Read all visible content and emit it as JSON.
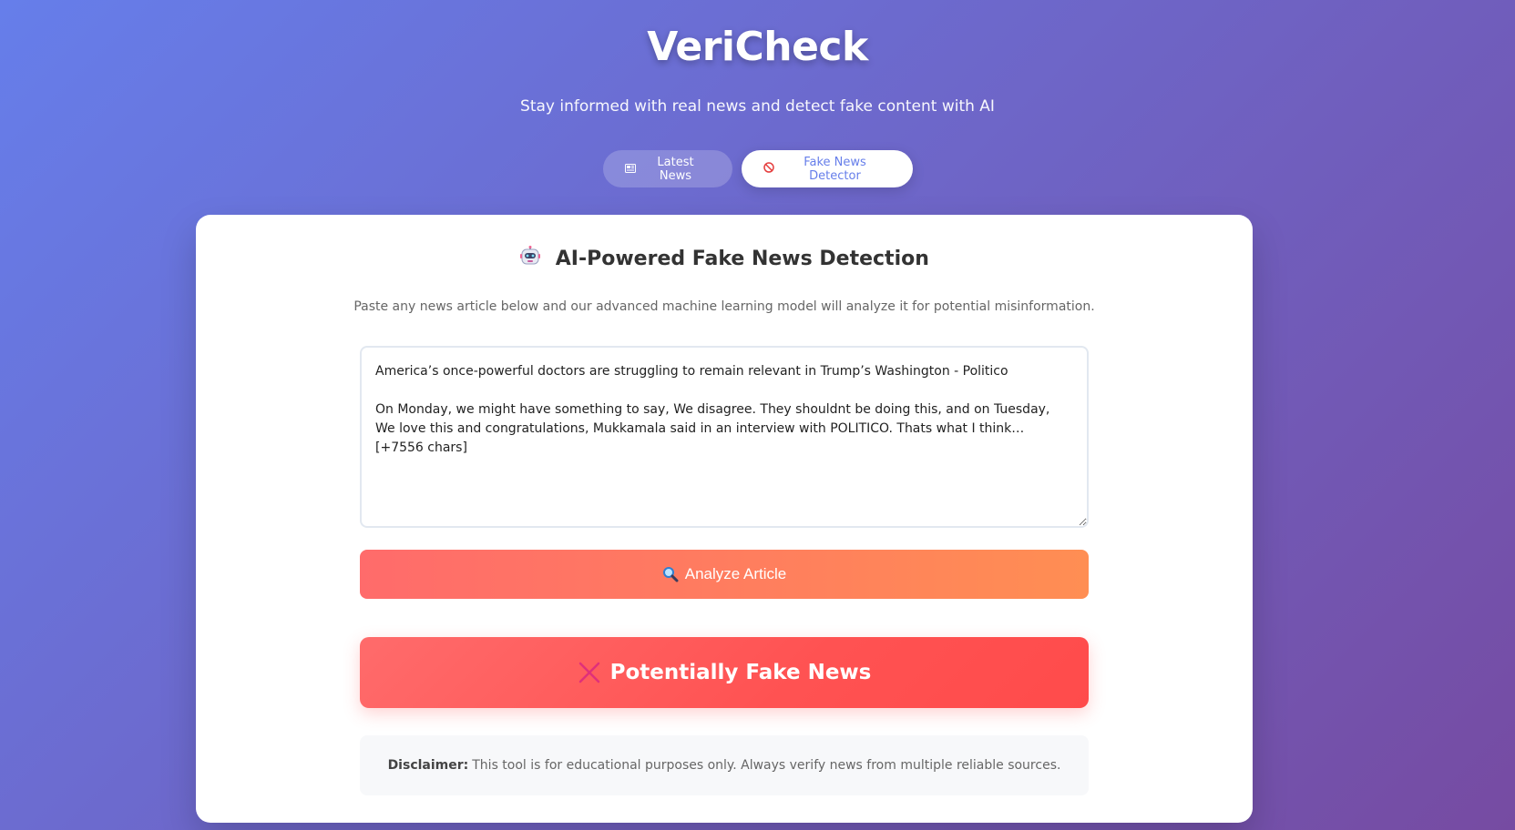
{
  "app": {
    "title": "VeriCheck",
    "subtitle": "Stay informed with real news and detect fake content with AI"
  },
  "tabs": [
    {
      "label": "Latest News",
      "icon": "newspaper-icon",
      "active": false
    },
    {
      "label": "Fake News Detector",
      "icon": "prohibited-icon",
      "active": true
    }
  ],
  "detector": {
    "heading": "AI-Powered Fake News Detection",
    "heading_icon": "robot-icon",
    "description": "Paste any news article below and our advanced machine learning model will analyze it for potential misinformation.",
    "article_text": "America’s once-powerful doctors are struggling to remain relevant in Trump’s Washington - Politico\n\nOn Monday, we might have something to say, We disagree. They shouldnt be doing this, and on Tuesday, We love this and congratulations, Mukkamala said in an interview with POLITICO. Thats what I think… [+7556 chars]",
    "analyze_label": "Analyze Article",
    "analyze_icon": "magnifying-glass-icon"
  },
  "result": {
    "label": "Potentially Fake News",
    "icon": "cross-icon",
    "color": "#ff5252"
  },
  "disclaimer": {
    "title": "Disclaimer:",
    "text": "This tool is for educational purposes only. Always verify news from multiple reliable sources."
  },
  "colors": {
    "background_start": "#667eea",
    "background_end": "#764ba2",
    "analyze_start": "#ff6b6b",
    "analyze_end": "#ff8e53"
  }
}
